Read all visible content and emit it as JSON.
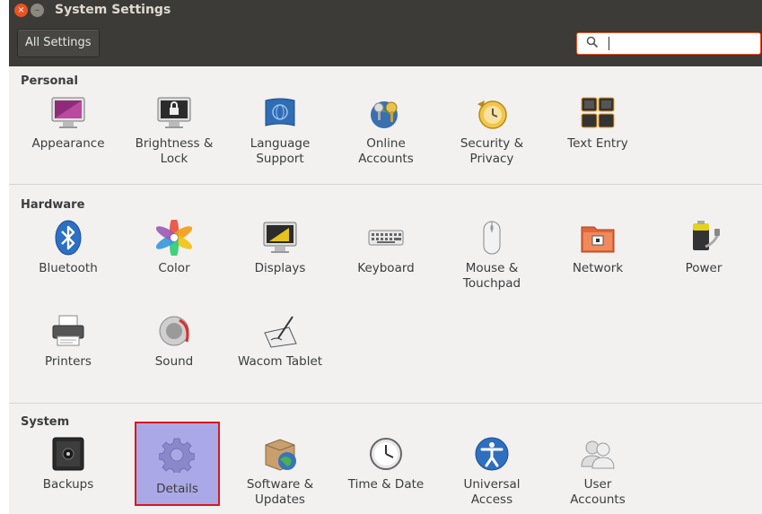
{
  "window": {
    "title": "System Settings",
    "close_glyph": "×",
    "minimize_glyph": "–"
  },
  "toolbar": {
    "all_settings_label": "All Settings",
    "search_icon": "⚲",
    "search_value": ""
  },
  "colors": {
    "titlebar": "#3c3b37",
    "accent": "#e95420",
    "content_bg": "#f2f1f0",
    "selected_bg": "#aaa8e6",
    "selected_border": "#d8181f"
  },
  "sections": {
    "personal": {
      "title": "Personal",
      "items": [
        {
          "label": "Appearance",
          "icon": "appearance-icon"
        },
        {
          "label": "Brightness &\nLock",
          "icon": "brightness-lock-icon"
        },
        {
          "label": "Language\nSupport",
          "icon": "language-support-icon"
        },
        {
          "label": "Online\nAccounts",
          "icon": "online-accounts-icon"
        },
        {
          "label": "Security &\nPrivacy",
          "icon": "security-privacy-icon"
        },
        {
          "label": "Text Entry",
          "icon": "text-entry-icon"
        }
      ]
    },
    "hardware": {
      "title": "Hardware",
      "items": [
        {
          "label": "Bluetooth",
          "icon": "bluetooth-icon"
        },
        {
          "label": "Color",
          "icon": "color-icon"
        },
        {
          "label": "Displays",
          "icon": "displays-icon"
        },
        {
          "label": "Keyboard",
          "icon": "keyboard-icon"
        },
        {
          "label": "Mouse &\nTouchpad",
          "icon": "mouse-icon"
        },
        {
          "label": "Network",
          "icon": "network-icon"
        },
        {
          "label": "Power",
          "icon": "power-icon"
        },
        {
          "label": "Printers",
          "icon": "printer-icon"
        },
        {
          "label": "Sound",
          "icon": "sound-icon"
        },
        {
          "label": "Wacom Tablet",
          "icon": "wacom-tablet-icon"
        }
      ]
    },
    "system": {
      "title": "System",
      "items": [
        {
          "label": "Backups",
          "icon": "backups-icon"
        },
        {
          "label": "Details",
          "icon": "details-gear-icon",
          "selected": true
        },
        {
          "label": "Software &\nUpdates",
          "icon": "software-updates-icon"
        },
        {
          "label": "Time & Date",
          "icon": "clock-icon"
        },
        {
          "label": "Universal\nAccess",
          "icon": "universal-access-icon"
        },
        {
          "label": "User\nAccounts",
          "icon": "user-accounts-icon"
        }
      ]
    }
  }
}
